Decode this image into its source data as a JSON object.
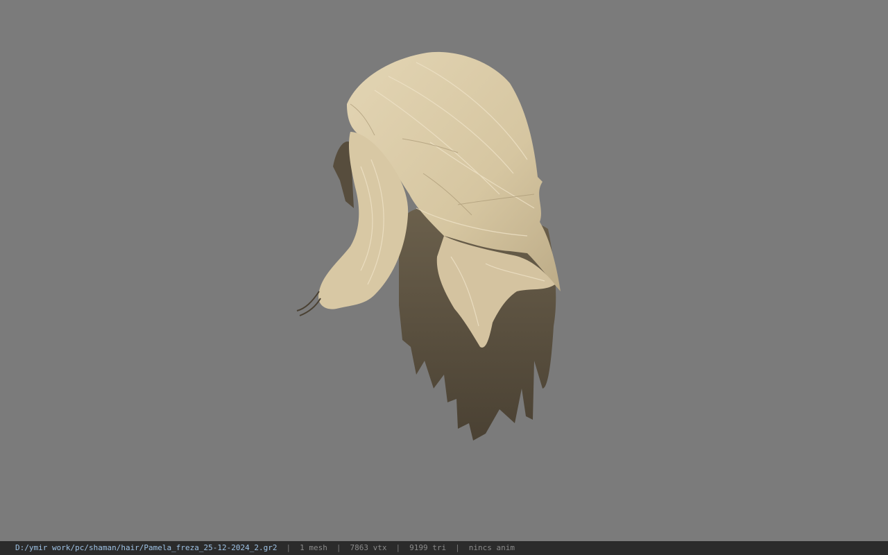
{
  "viewport": {
    "background": "#7b7b7b",
    "model_icon": "hair-mesh-icon",
    "hair_colors": {
      "light": "#d9c9a5",
      "mid": "#b3a281",
      "dark": "#4f4637"
    }
  },
  "statusbar": {
    "path": "D:/ymir work/pc/shaman/hair/Pamela_freza_25-12-2024_2.gr2",
    "separator": "|",
    "mesh": "1 mesh",
    "vertices": "7863 vtx",
    "triangles": "9199 tri",
    "anim": "nincs anim"
  }
}
